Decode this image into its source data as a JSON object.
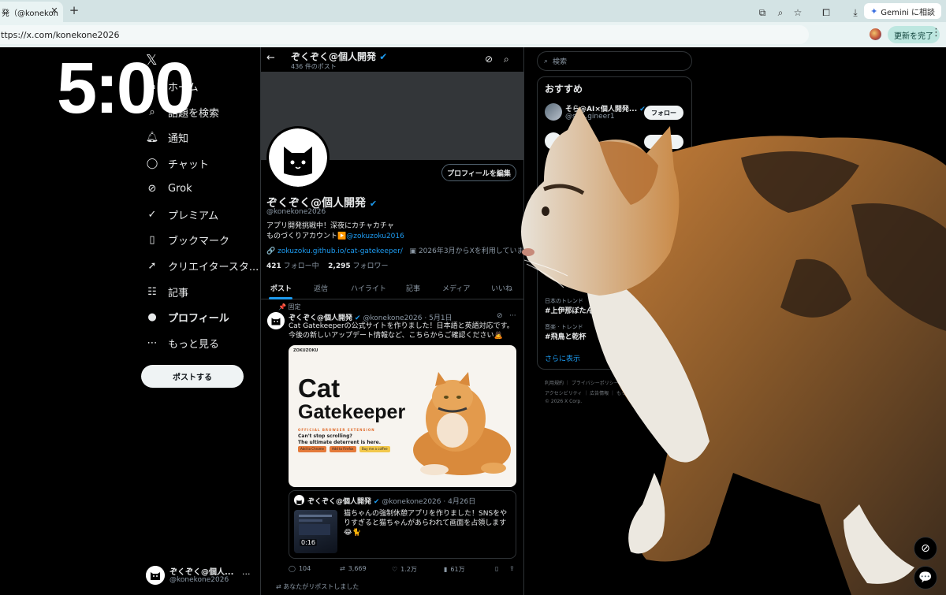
{
  "browser": {
    "tab_title": "発（@konekon",
    "tab_close": "✕",
    "newtab": "+",
    "gemini_label": "Gemini に相談",
    "url": "ttps://x.com/konekone2026",
    "update_label": "更新を完了",
    "kebab": "⋮"
  },
  "overlay": {
    "clock": "5:00"
  },
  "nav": {
    "logo": "𝕏",
    "items": [
      {
        "label": "ホーム",
        "icon": "home-icon"
      },
      {
        "label": "話題を検索",
        "icon": "search-icon"
      },
      {
        "label": "通知",
        "icon": "bell-icon"
      },
      {
        "label": "チャット",
        "icon": "chat-icon"
      },
      {
        "label": "Grok",
        "icon": "grok-icon"
      },
      {
        "label": "プレミアム",
        "icon": "premium-icon"
      },
      {
        "label": "ブックマーク",
        "icon": "bookmark-icon"
      },
      {
        "label": "クリエイタースタ...",
        "icon": "rocket-icon"
      },
      {
        "label": "記事",
        "icon": "article-icon"
      },
      {
        "label": "プロフィール",
        "icon": "person-icon"
      },
      {
        "label": "もっと見る",
        "icon": "more-icon"
      }
    ],
    "post_button": "ポストする",
    "account": {
      "name": "ぞくぞく@個人...",
      "handle": "@konekone2026",
      "more": "···"
    }
  },
  "profile": {
    "header_name": "ぞくぞく@個人開発",
    "post_count": "436 件のポスト",
    "edit_button": "プロフィールを編集",
    "name": "ぞくぞく@個人開発",
    "handle": "@konekone2026",
    "bio_line1": "アプリ開発挑戦中！深夜にカチャカチャ",
    "bio_line2_prefix": "ものづくりアカウント▶️",
    "bio_line2_link": "@zokuzoku2016",
    "link": "zokuzoku.github.io/cat-gatekeeper/",
    "joined": "2026年3月からXを利用しています",
    "following_count": "421",
    "following_label": "フォロー中",
    "followers_count": "2,295",
    "followers_label": "フォロワー",
    "tabs": [
      "ポスト",
      "返信",
      "ハイライト",
      "記事",
      "メディア",
      "いいね"
    ]
  },
  "tweet": {
    "pinned_label": "固定",
    "author": "ぞくぞく@個人開発",
    "handle": "@konekone2026",
    "date": "· 5月1日",
    "text": "Cat Gatekeeperの公式サイトを作りました！日本語と英語対応です。今後の新しいアップデート情報など、こちらからご確認ください🙇",
    "card": {
      "nav": "ZOKUZOKU",
      "title1": "Cat",
      "title2": "Gatekeeper",
      "subtitle": "OFFICIAL BROWSER EXTENSION",
      "tagline1": "Can't stop scrolling?",
      "tagline2": "The ultimate deterrent is here.",
      "btn1": "Add to Chrome",
      "btn2": "Add to Firefox",
      "btn3": "Buy me a coffee"
    },
    "quote": {
      "author": "ぞくぞく@個人開発",
      "handle": "@konekone2026",
      "date": "· 4月26日",
      "text": "猫ちゃんの強制休憩アプリを作りました！SNSをやりすぎると猫ちゃんがあらわれて画面を占領します😂🐈",
      "video_time": "0:16"
    },
    "replies": "104",
    "reposts": "3,669",
    "likes": "1.2万",
    "views": "61万"
  },
  "next_tweet": {
    "repost_label": "あなたがリポストしました"
  },
  "sidebar": {
    "search_placeholder": "検索",
    "recommend_title": "おすすめ",
    "rec_name": "そら@AI×個人開発...",
    "rec_handle": "@so…gineer1",
    "follow_label": "フォロー",
    "trends": [
      {
        "category": "日本のトレンド",
        "name": "#上伊那ぼたん"
      },
      {
        "category": "音楽 · トレンド",
        "name": "#飛鳥と乾杯"
      }
    ],
    "show_more": "さらに表示",
    "footer_line1": "利用規約 ｜ プライバシーポリシー ｜ Cookieのポリ",
    "footer_line2": "アクセシビリティ ｜ 広告情報 ｜ もっと見る ···",
    "footer_line3": "© 2026 X Corp."
  },
  "colors": {
    "accent": "#1d9bf0",
    "background": "#000000",
    "chrome": "#d3e3e4",
    "update_button": "#bde7e0"
  }
}
